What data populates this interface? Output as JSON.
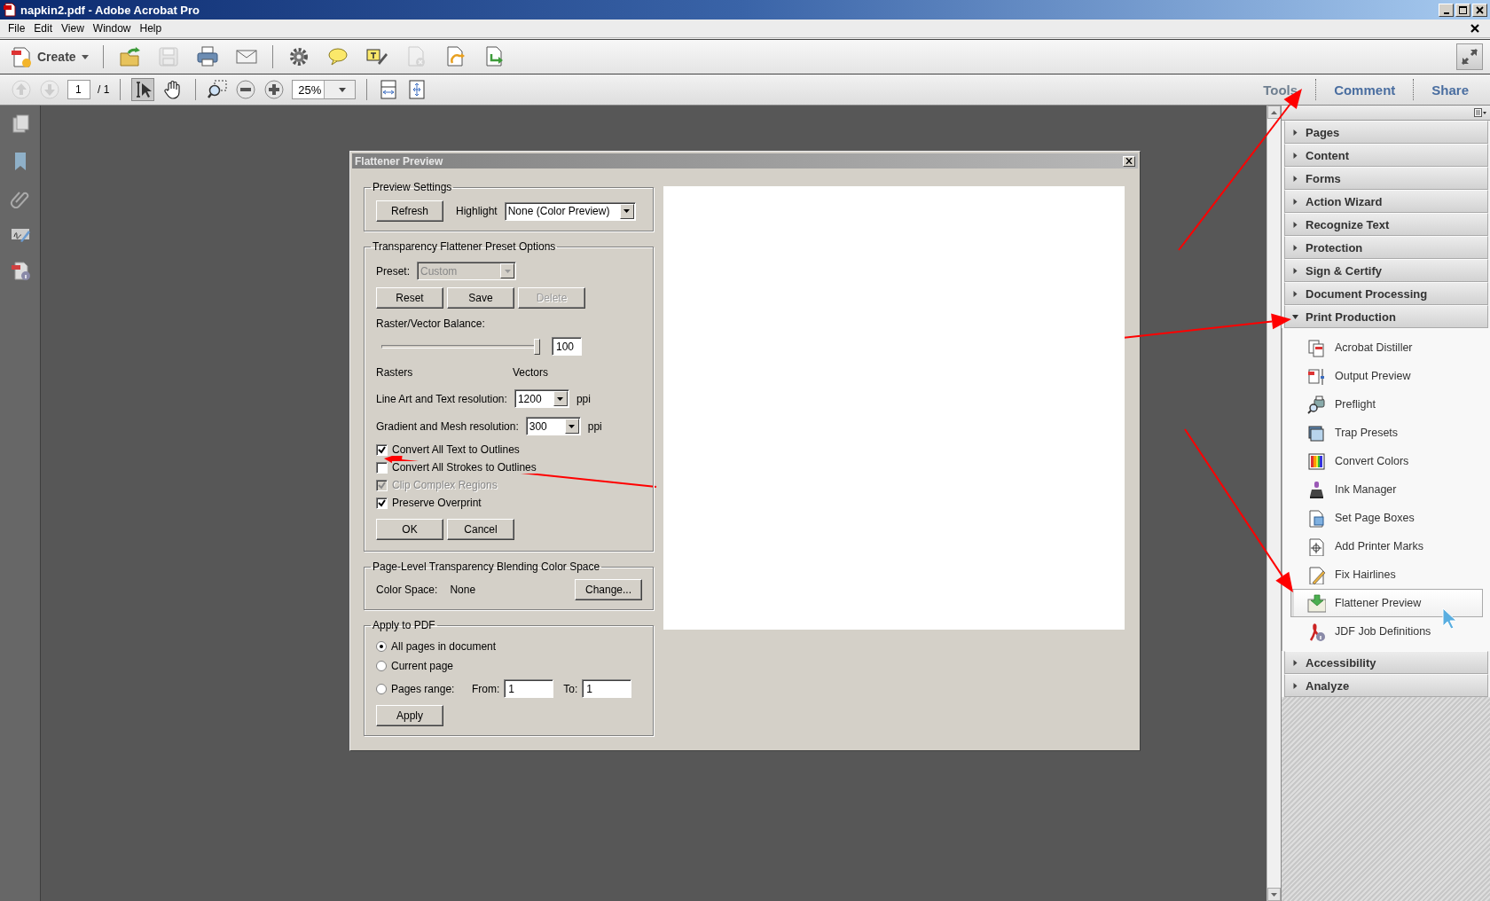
{
  "window": {
    "title": "napkin2.pdf - Adobe Acrobat Pro"
  },
  "menu": [
    "File",
    "Edit",
    "View",
    "Window",
    "Help"
  ],
  "toolbar": {
    "create": "Create",
    "icon_groups": [
      [
        {
          "kind": "open",
          "disabled": false
        },
        {
          "kind": "save",
          "disabled": true
        },
        {
          "kind": "print",
          "disabled": false
        },
        {
          "kind": "mail",
          "disabled": false
        }
      ],
      [
        {
          "kind": "gear",
          "disabled": false
        },
        {
          "kind": "comment",
          "disabled": false
        },
        {
          "kind": "highlight",
          "disabled": false
        },
        {
          "kind": "doc-remove",
          "disabled": true
        },
        {
          "kind": "doc-send",
          "disabled": false
        },
        {
          "kind": "doc-export",
          "disabled": false
        }
      ]
    ]
  },
  "navbar": {
    "nav_buttons": [
      {
        "kind": "previous",
        "disabled": true
      },
      {
        "kind": "next",
        "disabled": true
      }
    ],
    "page": "1",
    "page_total": "/ 1",
    "tools": [
      {
        "kind": "select",
        "selected": true
      },
      {
        "kind": "hand",
        "selected": false
      }
    ],
    "zoom_buttons": [
      {
        "kind": "marquee"
      },
      {
        "kind": "zoom-out"
      },
      {
        "kind": "zoom-in"
      }
    ],
    "zoom": "25%",
    "fit_buttons": [
      {
        "kind": "fit-width"
      },
      {
        "kind": "fit-page"
      }
    ]
  },
  "tabs": [
    {
      "label": "Tools",
      "selected": true
    },
    {
      "label": "Comment",
      "selected": false
    },
    {
      "label": "Share",
      "selected": false
    }
  ],
  "sidebar": {
    "icons": [
      {
        "kind": "pages"
      },
      {
        "kind": "bookmarks"
      },
      {
        "kind": "attachments"
      },
      {
        "kind": "signatures"
      },
      {
        "kind": "properties"
      }
    ]
  },
  "dialog": {
    "title": "Flattener Preview",
    "preview_settings": {
      "legend": "Preview Settings",
      "refresh": "Refresh",
      "highlight_label": "Highlight",
      "highlight_value": "None (Color Preview)"
    },
    "preset_options": {
      "legend": "Transparency Flattener Preset Options",
      "preset_label": "Preset:",
      "preset_value": "Custom",
      "preset_disabled": true,
      "buttons": [
        {
          "label": "Reset",
          "disabled": false
        },
        {
          "label": "Save",
          "disabled": false
        },
        {
          "label": "Delete",
          "disabled": true
        }
      ],
      "balance_label": "Raster/Vector Balance:",
      "balance": {
        "level": 1.0
      },
      "balance_value": "100",
      "rasters_label": "Rasters",
      "vectors_label": "Vectors",
      "resolutions": [
        {
          "label": "Line Art and Text resolution:",
          "value": "1200",
          "unit": "ppi"
        },
        {
          "label": "Gradient and Mesh resolution:",
          "value": "300",
          "unit": "ppi"
        }
      ],
      "checkboxes": [
        {
          "label": "Convert All Text to Outlines",
          "checked": true,
          "disabled": false
        },
        {
          "label": "Convert All Strokes to Outlines",
          "checked": false,
          "disabled": false
        },
        {
          "label": "Clip Complex Regions",
          "checked": true,
          "disabled": true
        },
        {
          "label": "Preserve Overprint",
          "checked": true,
          "disabled": false
        }
      ],
      "ok": "OK",
      "cancel": "Cancel"
    },
    "color_space": {
      "legend": "Page-Level Transparency Blending Color Space",
      "label": "Color Space:",
      "value": "None",
      "button": "Change..."
    },
    "apply": {
      "legend": "Apply to PDF",
      "radios": [
        {
          "label": "All pages in document",
          "selected": true
        },
        {
          "label": "Current page",
          "selected": false
        },
        {
          "label": "Pages range:",
          "selected": false
        }
      ],
      "from_label": "From:",
      "from_value": "1",
      "to_label": "To:",
      "to_value": "1",
      "button": "Apply"
    }
  },
  "tool_panel": {
    "sections": [
      {
        "label": "Pages",
        "expanded": false
      },
      {
        "label": "Content",
        "expanded": false
      },
      {
        "label": "Forms",
        "expanded": false
      },
      {
        "label": "Action Wizard",
        "expanded": false
      },
      {
        "label": "Recognize Text",
        "expanded": false
      },
      {
        "label": "Protection",
        "expanded": false
      },
      {
        "label": "Sign & Certify",
        "expanded": false
      },
      {
        "label": "Document Processing",
        "expanded": false
      },
      {
        "label": "Print Production",
        "expanded": true,
        "items": [
          {
            "kind": "distiller",
            "label": "Acrobat Distiller",
            "selected": false
          },
          {
            "kind": "output",
            "label": "Output Preview",
            "selected": false
          },
          {
            "kind": "preflight",
            "label": "Preflight",
            "selected": false
          },
          {
            "kind": "trap",
            "label": "Trap Presets",
            "selected": false
          },
          {
            "kind": "colors",
            "label": "Convert Colors",
            "selected": false
          },
          {
            "kind": "ink",
            "label": "Ink Manager",
            "selected": false
          },
          {
            "kind": "boxes",
            "label": "Set Page Boxes",
            "selected": false
          },
          {
            "kind": "marks",
            "label": "Add Printer Marks",
            "selected": false
          },
          {
            "kind": "hairlines",
            "label": "Fix Hairlines",
            "selected": false
          },
          {
            "kind": "flattener",
            "label": "Flattener Preview",
            "selected": true
          },
          {
            "kind": "jdf",
            "label": "JDF Job Definitions",
            "selected": false
          }
        ]
      },
      {
        "label": "Accessibility",
        "expanded": false
      },
      {
        "label": "Analyze",
        "expanded": false
      }
    ]
  }
}
